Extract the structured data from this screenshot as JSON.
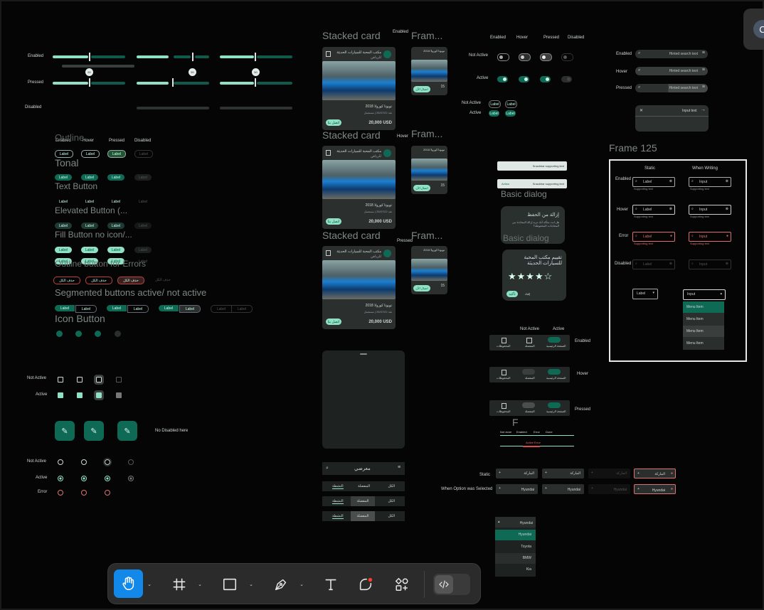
{
  "sliders": {
    "row_labels": [
      "Enabled",
      "Pressed",
      "Disabled"
    ],
    "knob_values": [
      "50",
      "50",
      "50"
    ]
  },
  "buttons_panel": {
    "col_headers": [
      "Enabled",
      "Hover",
      "Pressed",
      "Disabled"
    ],
    "sections": [
      "Outline",
      "Tonal",
      "Text Button",
      "Elevated Button (...",
      "Fill Button no icon/...",
      "Outline button for Errors",
      "Segmented buttons active/ not active",
      "Icon Button"
    ],
    "label": "Label",
    "error_label": "حذف الكل",
    "no_disabled": "No Disabled here"
  },
  "selection": {
    "not_active": "Not Active",
    "active": "Active",
    "error": "Error"
  },
  "stacked_cards": {
    "title": "Stacked card",
    "frame_title": "Fram...",
    "states": [
      "Enabled",
      "Hover",
      "Pressed"
    ],
    "card_name": "مكتب المحبة للسيارات الحديثة",
    "card_sub": "للرياض",
    "car_model": "تويوتا كورولا 2018",
    "car_meta": "نقد 25/07/22 | مستعمل",
    "price": "20,000 USD",
    "cta": "اتصل بنا",
    "thumb_title": "تويوتا كورولا 2018",
    "thumb_price": "15",
    "thumb_cta": "اتصال الآن"
  },
  "bottom_sheet": {
    "title": "معرضي",
    "tabs": [
      "الكل",
      "المفضلة",
      "النشطة"
    ]
  },
  "toggles": {
    "col_headers": [
      "Enabled",
      "Hover",
      "Pressed",
      "Disabled"
    ],
    "row_labels": [
      "Not Active",
      "Active"
    ],
    "chip_label": "Label"
  },
  "snackbar": {
    "text": "Snackbar supporting text",
    "action": "Action"
  },
  "dialogs": {
    "title": "Basic dialog",
    "delete_title": "إزالة من الحفظ",
    "delete_body": "هل انت متأكد أنك تريد إزالة المحادثة من المحادثات المحفوظة؟",
    "rate_title": "تقييم مكتب المحبة للسيارات الحديثة",
    "stars": "★★★★☆",
    "confirm": "تأكيد",
    "cancel": "إلغاء"
  },
  "navigation": {
    "col_headers": [
      "Not Active",
      "Active"
    ],
    "states": [
      "Enabled",
      "Hover",
      "Pressed"
    ],
    "items": [
      "الصفحة الرئيسية",
      "المفضلة",
      "المحفوظات"
    ]
  },
  "steps": {
    "letter": "F",
    "labels": [
      "Not done",
      "Enabled",
      "Error",
      "Done"
    ],
    "active_error": "Active Error"
  },
  "search": {
    "states": [
      "Enabled",
      "Hover",
      "Pressed"
    ],
    "placeholder": "Hinted search text",
    "input_text": "Input text"
  },
  "frame125": {
    "title": "Frame 125",
    "col_headers": [
      "Static",
      "When Writing"
    ],
    "row_labels": [
      "Enabled",
      "Hover",
      "Error",
      "Disabled"
    ],
    "label": "Label",
    "input": "Input",
    "support": "Supporting text",
    "menu_items": [
      "Menu Item",
      "Menu Item",
      "Menu Item",
      "Menu Item"
    ]
  },
  "dropdowns": {
    "row_labels": [
      "Static",
      "When Option was Selected"
    ],
    "placeholder": "الماركة",
    "selected": "Hyundai",
    "list": [
      "Hyundai",
      "Toyota",
      "BMW",
      "Kia"
    ]
  },
  "toolbar": {
    "icons": [
      "hand-tool-icon",
      "frame-tool-icon",
      "rectangle-tool-icon",
      "pen-tool-icon",
      "text-tool-icon",
      "shape-tool-icon",
      "components-icon",
      "code-icon"
    ]
  },
  "colors": {
    "accent": "#0e6a55",
    "accent_light": "#8fe0c6",
    "bg": "#050505",
    "toolbar_active": "#1288e8"
  }
}
